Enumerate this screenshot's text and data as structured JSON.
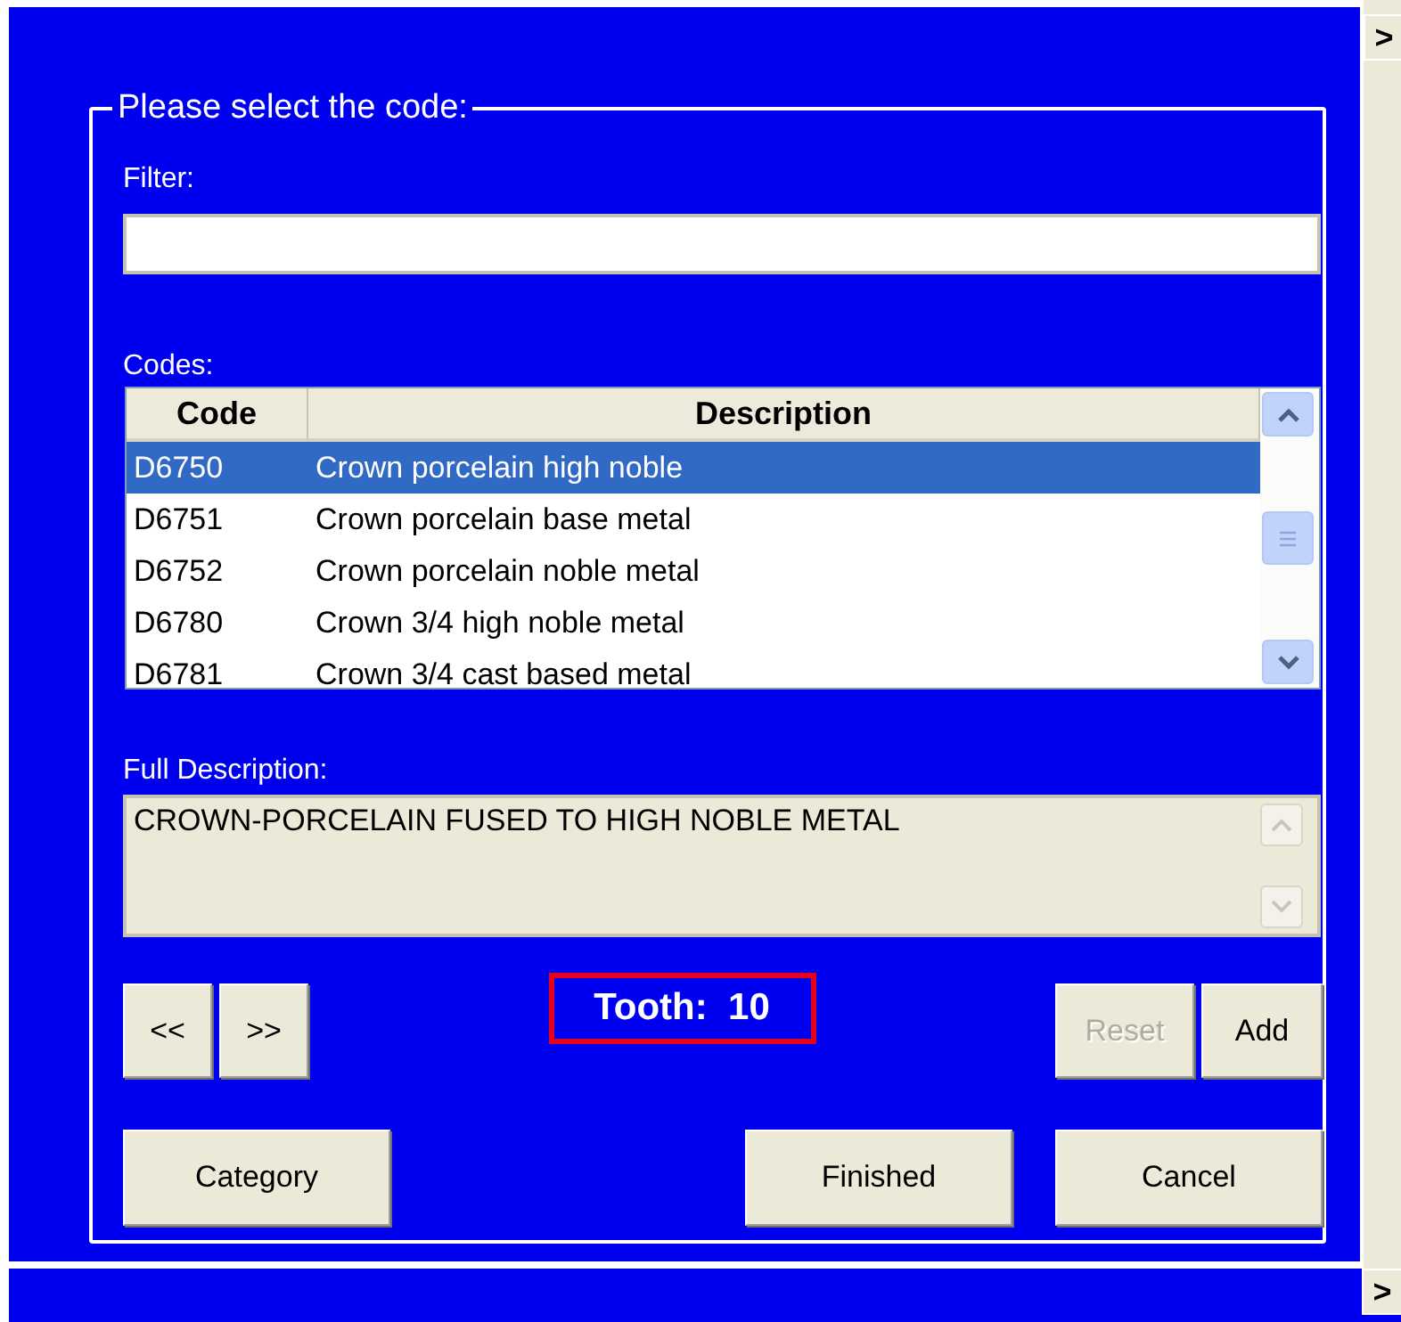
{
  "group": {
    "title": "Please select the code:"
  },
  "filter": {
    "label": "Filter:"
  },
  "codes": {
    "label": "Codes:",
    "columns": [
      "Code",
      "Description"
    ],
    "rows": [
      {
        "code": "D6750",
        "description": "Crown porcelain high noble",
        "selected": true
      },
      {
        "code": "D6751",
        "description": "Crown porcelain base metal",
        "selected": false
      },
      {
        "code": "D6752",
        "description": "Crown porcelain noble metal",
        "selected": false
      },
      {
        "code": "D6780",
        "description": "Crown 3/4 high noble metal",
        "selected": false
      },
      {
        "code": "D6781",
        "description": "Crown 3/4 cast based metal",
        "selected": false
      }
    ]
  },
  "full_description": {
    "label": "Full Description:",
    "value": "CROWN-PORCELAIN FUSED TO HIGH NOBLE METAL"
  },
  "nav_buttons": [
    {
      "label": "<<",
      "disabled": false
    },
    {
      "label": ">>",
      "disabled": false
    }
  ],
  "tooth": {
    "label": "Tooth:  10"
  },
  "edit_buttons": [
    {
      "label": "Reset",
      "disabled": true
    },
    {
      "label": "Add",
      "disabled": false
    }
  ],
  "bottom_buttons": [
    {
      "label": "Category",
      "disabled": false
    },
    {
      "label": "Finished",
      "disabled": false
    },
    {
      "label": "Cancel",
      "disabled": false
    }
  ],
  "side_buttons": [
    ">",
    ">"
  ]
}
